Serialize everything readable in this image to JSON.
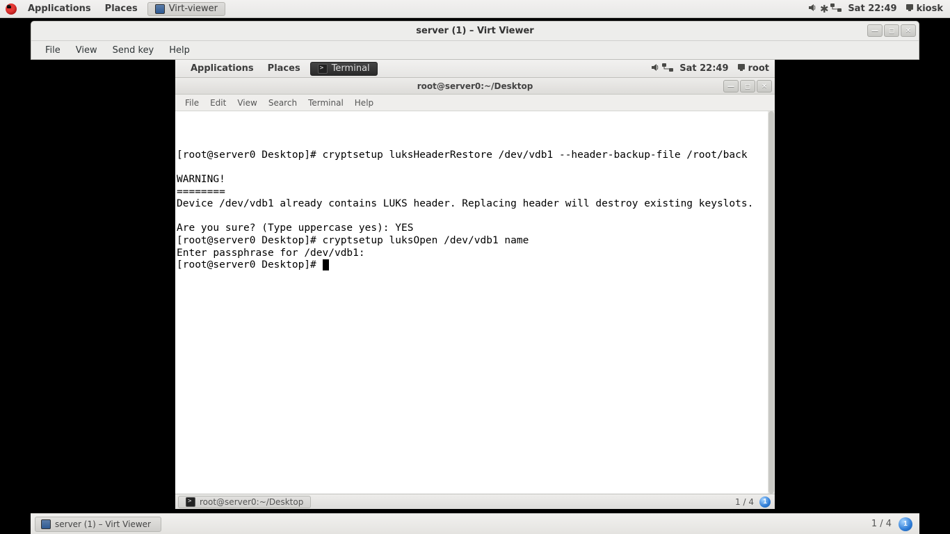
{
  "host_panel": {
    "applications": "Applications",
    "places": "Places",
    "task_app": "Virt-viewer",
    "clock": "Sat 22:49",
    "user": "kiosk"
  },
  "virt_window": {
    "title": "server (1) – Virt Viewer",
    "menu": {
      "file": "File",
      "view": "View",
      "sendkey": "Send key",
      "help": "Help"
    }
  },
  "guest_panel": {
    "applications": "Applications",
    "places": "Places",
    "task_app": "Terminal",
    "clock": "Sat 22:49",
    "user": "root"
  },
  "terminal": {
    "title": "root@server0:~/Desktop",
    "menu": {
      "file": "File",
      "edit": "Edit",
      "view": "View",
      "search": "Search",
      "terminal": "Terminal",
      "help": "Help"
    },
    "content": "\n\n\n[root@server0 Desktop]# cryptsetup luksHeaderRestore /dev/vdb1 --header-backup-file /root/back\n\nWARNING!\n========\nDevice /dev/vdb1 already contains LUKS header. Replacing header will destroy existing keyslots.\n\nAre you sure? (Type uppercase yes): YES\n[root@server0 Desktop]# cryptsetup luksOpen /dev/vdb1 name\nEnter passphrase for /dev/vdb1: \n[root@server0 Desktop]# "
  },
  "guest_bottom": {
    "task": "root@server0:~/Desktop",
    "pager": "1 / 4",
    "badge": "1"
  },
  "host_bottom": {
    "task": "server (1) – Virt Viewer",
    "pager": "1 / 4",
    "badge": "1"
  }
}
